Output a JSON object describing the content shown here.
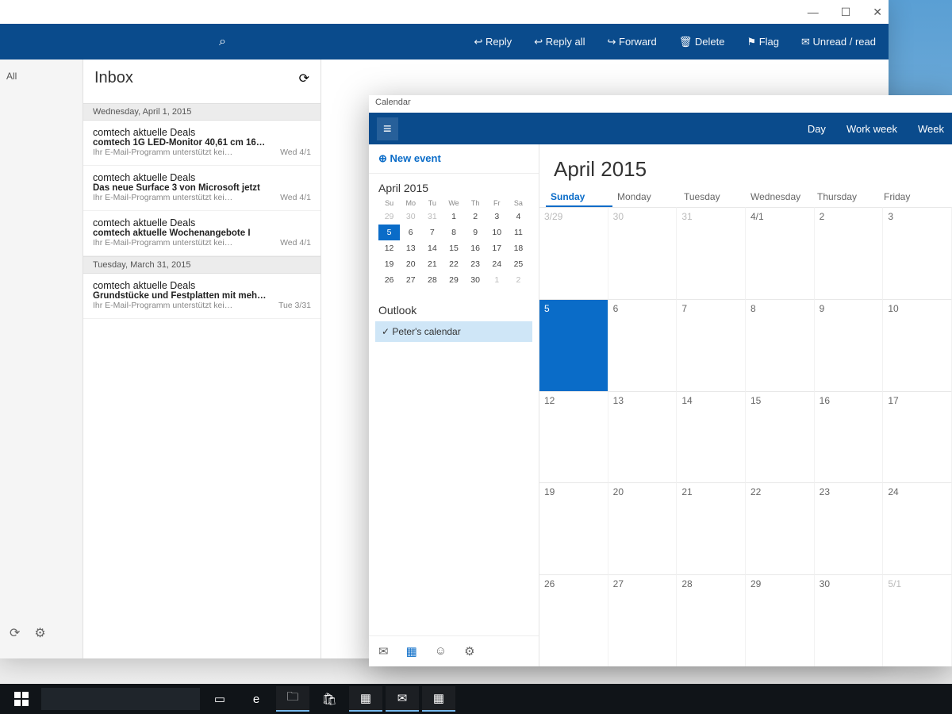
{
  "mail": {
    "titlebar": {
      "minimize": "—",
      "maximize": "☐",
      "close": "✕"
    },
    "search_icon": "⌕",
    "toolbar": {
      "reply": "↩ Reply",
      "reply_all": "↩ Reply all",
      "forward": "↪ Forward",
      "delete": "🗑 Delete",
      "flag": "⚑ Flag",
      "mark_unread": "✉ Unread / read"
    },
    "sidebar": {
      "all": "All",
      "sync_icon": "⟳",
      "settings_icon": "⚙"
    },
    "inbox_title": "Inbox",
    "refresh_icon": "⟳",
    "groups": [
      {
        "label": "Wednesday, April 1, 2015",
        "items": [
          {
            "from": "comtech aktuelle Deals",
            "subject": "comtech 1G LED-Monitor 40,61 cm 16…",
            "preview": "Ihr E-Mail-Programm unterstützt kei…",
            "time": "Wed 4/1"
          },
          {
            "from": "comtech aktuelle Deals",
            "subject": "Das neue Surface 3 von Microsoft jetzt",
            "preview": "Ihr E-Mail-Programm unterstützt kei…",
            "time": "Wed 4/1"
          },
          {
            "from": "comtech aktuelle Deals",
            "subject": "comtech aktuelle Wochenangebote I",
            "preview": "Ihr E-Mail-Programm unterstützt kei…",
            "time": "Wed 4/1"
          }
        ]
      },
      {
        "label": "Tuesday, March 31, 2015",
        "items": [
          {
            "from": "comtech aktuelle Deals",
            "subject": "Grundstücke und Festplatten mit meh…",
            "preview": "Ihr E-Mail-Programm unterstützt kei…",
            "time": "Tue 3/31"
          }
        ]
      }
    ]
  },
  "calendar": {
    "title": "Calendar",
    "hamburger": "≡",
    "views": {
      "day": "Day",
      "workweek": "Work week",
      "week": "Week"
    },
    "new_event": "⊕ New event",
    "mini": {
      "title": "April 2015",
      "dow": [
        "Su",
        "Mo",
        "Tu",
        "We",
        "Th",
        "Fr",
        "Sa"
      ],
      "cells": [
        {
          "t": "29",
          "dim": true
        },
        {
          "t": "30",
          "dim": true
        },
        {
          "t": "31",
          "dim": true
        },
        {
          "t": "1"
        },
        {
          "t": "2"
        },
        {
          "t": "3"
        },
        {
          "t": "4"
        },
        {
          "t": "5",
          "sel": true
        },
        {
          "t": "6"
        },
        {
          "t": "7"
        },
        {
          "t": "8"
        },
        {
          "t": "9"
        },
        {
          "t": "10"
        },
        {
          "t": "11"
        },
        {
          "t": "12"
        },
        {
          "t": "13"
        },
        {
          "t": "14"
        },
        {
          "t": "15"
        },
        {
          "t": "16"
        },
        {
          "t": "17"
        },
        {
          "t": "18"
        },
        {
          "t": "19"
        },
        {
          "t": "20"
        },
        {
          "t": "21"
        },
        {
          "t": "22"
        },
        {
          "t": "23"
        },
        {
          "t": "24"
        },
        {
          "t": "25"
        },
        {
          "t": "26"
        },
        {
          "t": "27"
        },
        {
          "t": "28"
        },
        {
          "t": "29"
        },
        {
          "t": "30"
        },
        {
          "t": "1",
          "dim": true
        },
        {
          "t": "2",
          "dim": true
        }
      ]
    },
    "accounts_label": "Outlook",
    "calendar_entry": "✓ Peter's calendar",
    "side_icons": {
      "mail": "✉",
      "calendar": "▦",
      "people": "☺",
      "settings": "⚙"
    },
    "main": {
      "title": "April 2015",
      "dow": [
        "Sunday",
        "Monday",
        "Tuesday",
        "Wednesday",
        "Thursday",
        "Friday"
      ],
      "today_index": 0,
      "cells": [
        {
          "t": "3/29",
          "dim": true
        },
        {
          "t": "30",
          "dim": true
        },
        {
          "t": "31",
          "dim": true
        },
        {
          "t": "4/1"
        },
        {
          "t": "2"
        },
        {
          "t": "3"
        },
        {
          "t": "5",
          "sel": true
        },
        {
          "t": "6"
        },
        {
          "t": "7"
        },
        {
          "t": "8"
        },
        {
          "t": "9"
        },
        {
          "t": "10"
        },
        {
          "t": "12"
        },
        {
          "t": "13"
        },
        {
          "t": "14"
        },
        {
          "t": "15"
        },
        {
          "t": "16"
        },
        {
          "t": "17"
        },
        {
          "t": "19"
        },
        {
          "t": "20"
        },
        {
          "t": "21"
        },
        {
          "t": "22"
        },
        {
          "t": "23"
        },
        {
          "t": "24"
        },
        {
          "t": "26"
        },
        {
          "t": "27"
        },
        {
          "t": "28"
        },
        {
          "t": "29"
        },
        {
          "t": "30"
        },
        {
          "t": "5/1",
          "dim": true
        }
      ]
    }
  },
  "taskbar": {
    "items": [
      {
        "name": "start",
        "glyph": "",
        "running": false
      },
      {
        "name": "search",
        "glyph": "",
        "running": false
      },
      {
        "name": "task-view",
        "glyph": "▭",
        "running": false
      },
      {
        "name": "edge",
        "glyph": "e",
        "running": false
      },
      {
        "name": "explorer",
        "glyph": "🗀",
        "running": true
      },
      {
        "name": "store",
        "glyph": "🛍",
        "running": false
      },
      {
        "name": "app1",
        "glyph": "▦",
        "running": true
      },
      {
        "name": "mail",
        "glyph": "✉",
        "running": true
      },
      {
        "name": "calendar",
        "glyph": "▦",
        "running": true
      }
    ]
  }
}
